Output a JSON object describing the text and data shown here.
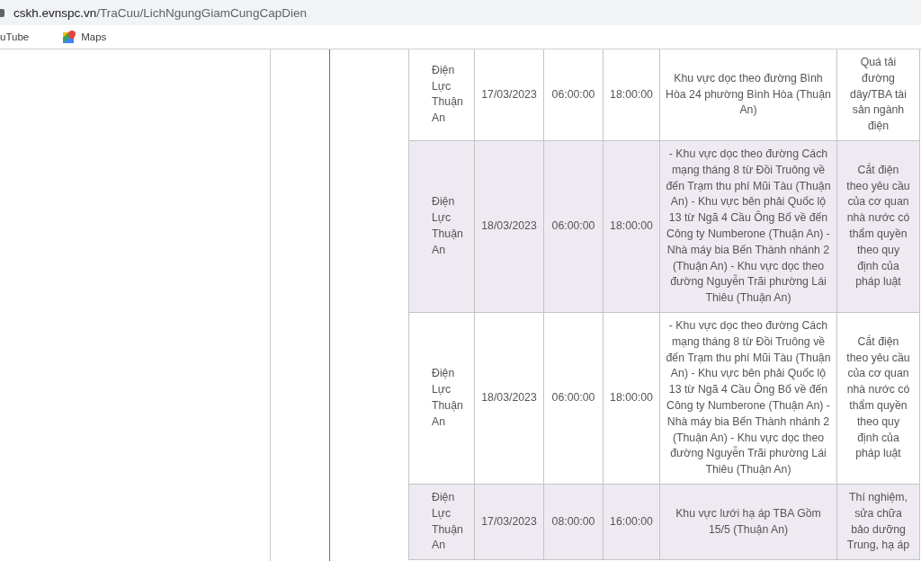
{
  "address_bar": {
    "host": "cskh.evnspc.vn",
    "path": "/TraCuu/LichNgungGiamCungCapDien"
  },
  "bookmarks": [
    {
      "label": "uTube",
      "kind": "plain"
    },
    {
      "label": "Maps",
      "kind": "maps"
    }
  ],
  "table": {
    "rows": [
      {
        "cells": [
          "Điện Lực Thuận An",
          "17/03/2023",
          "06:00:00",
          "18:00:00",
          "Khu vực dọc theo đường Bình Hòa 24 phường Bình Hòa (Thuận An)",
          "Quá tải đường dây/TBA tài sản ngành điện"
        ]
      },
      {
        "cells": [
          "Điện Lực Thuận An",
          "18/03/2023",
          "06:00:00",
          "18:00:00",
          "- Khu vực dọc theo đường Cách mạng tháng 8 từ Đồi Truông về đến Trạm thu phí Mũi Tàu (Thuận An) - Khu vực bên phải Quốc lộ 13 từ Ngã 4 Cầu Ông Bố về đến Công ty Numberone (Thuận An) - Nhà máy bia Bến Thành nhánh 2 (Thuận An) - Khu vực dọc theo đường Nguyễn Trãi phường Lái Thiêu (Thuận An)",
          "Cắt điện theo yêu cầu của cơ quan nhà nước có thẩm quyền theo quy định của pháp luật"
        ]
      },
      {
        "cells": [
          "Điện Lực Thuận An",
          "18/03/2023",
          "06:00:00",
          "18:00:00",
          "- Khu vực dọc theo đường Cách mạng tháng 8 từ Đồi Truông về đến Trạm thu phí Mũi Tàu (Thuận An) - Khu vực bên phải Quốc lộ 13 từ Ngã 4 Cầu Ông Bố về đến Công ty Numberone (Thuận An) - Nhà máy bia Bến Thành nhánh 2 (Thuận An) - Khu vực dọc theo đường Nguyễn Trãi phường Lái Thiêu (Thuận An)",
          "Cắt điện theo yêu cầu của cơ quan nhà nước có thẩm quyền theo quy định của pháp luật"
        ]
      },
      {
        "cells": [
          "Điện Lực Thuận An",
          "17/03/2023",
          "08:00:00",
          "16:00:00",
          "Khu vực lưới hạ áp TBA Gồm 15/5 (Thuận An)",
          "Thí nghiệm, sửa chữa bảo dưỡng Trung, hạ áp"
        ]
      }
    ]
  }
}
